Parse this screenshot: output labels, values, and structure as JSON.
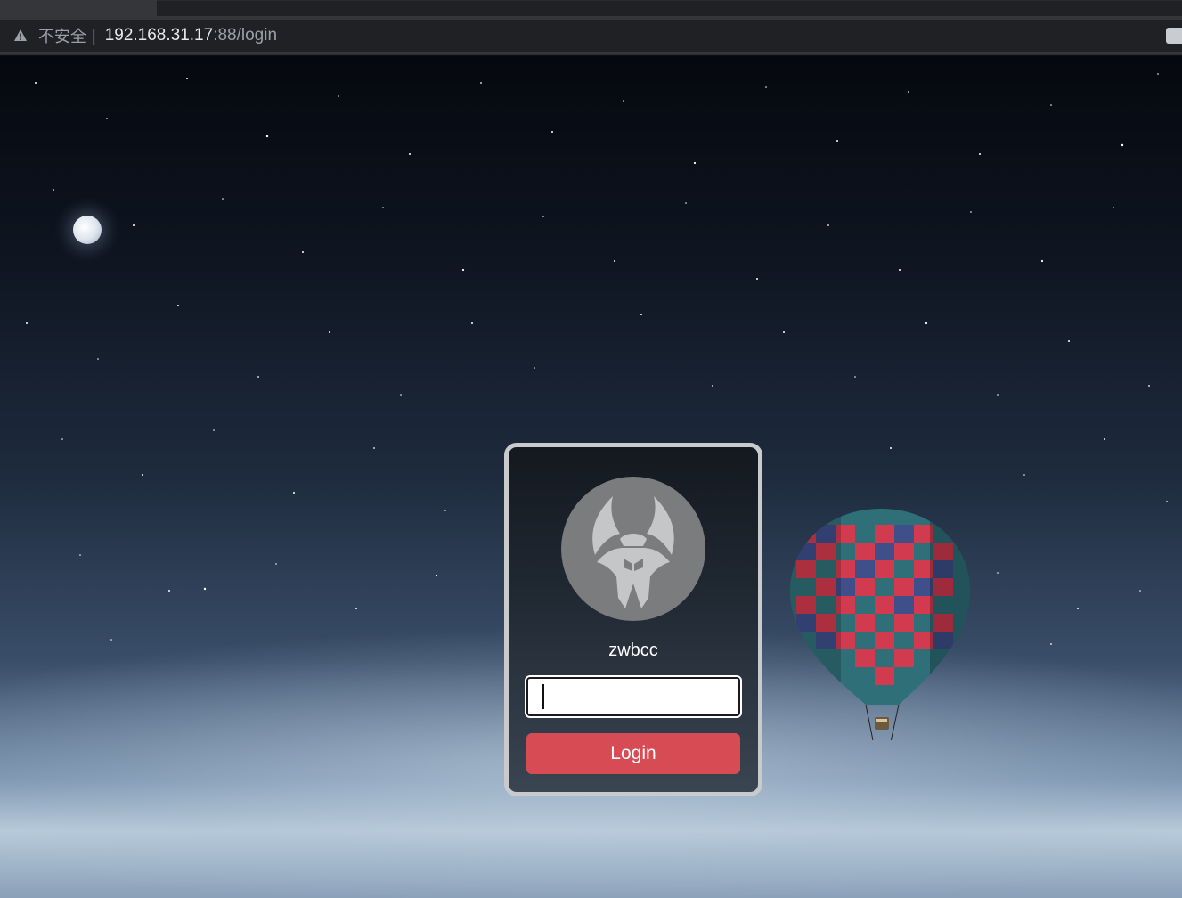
{
  "browser": {
    "security_label": "不安全",
    "separator": "|",
    "url_host": "192.168.31.17",
    "url_rest": ":88/login"
  },
  "login": {
    "username": "zwbcc",
    "password_value": "",
    "button_label": "Login"
  },
  "colors": {
    "button": "#d74c54",
    "card_border": "#c8cacc",
    "avatar_bg": "#7a7c7d"
  }
}
